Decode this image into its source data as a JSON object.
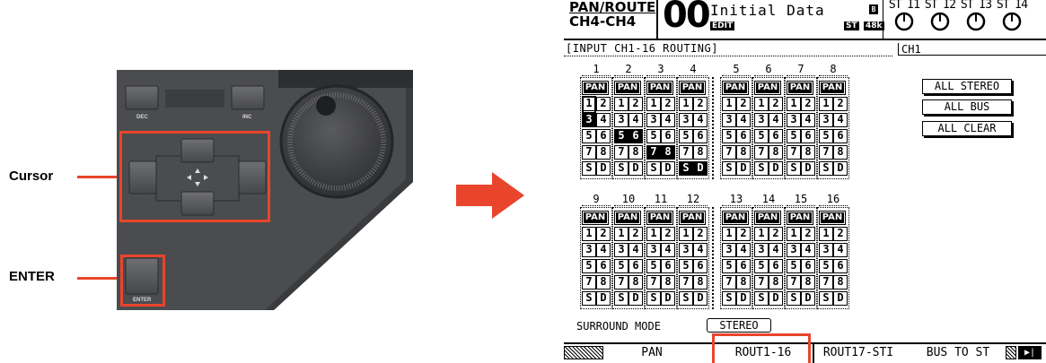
{
  "callouts": {
    "cursor": "Cursor",
    "enter": "ENTER"
  },
  "hardware": {
    "dec_label": "DEC",
    "inc_label": "INC",
    "enter_label": "ENTER",
    "accent": "#e8452c",
    "panel_color": "#4a4b4d"
  },
  "lcd": {
    "title_line1": "PAN/ROUTE",
    "title_line2": "CH4-CH4",
    "scene_number": "00",
    "scene_title": "Initial Data",
    "edit_badge": "EDIT",
    "st_badge": "ST",
    "fs_badge": "48k",
    "b_badge": "B",
    "stereo_inputs": [
      "ST I1",
      "ST I2",
      "ST I3",
      "ST I4"
    ],
    "section_title": "INPUT CH1-16 ROUTING",
    "channel_name": "CH1",
    "pan_label": "PAN",
    "bus_labels": [
      "1",
      "2",
      "3",
      "4",
      "5",
      "6",
      "7",
      "8"
    ],
    "stereo_label": "S",
    "direct_label": "D",
    "group1_channels": [
      "1",
      "2",
      "3",
      "4",
      "5",
      "6",
      "7",
      "8"
    ],
    "group2_channels": [
      "9",
      "10",
      "11",
      "12",
      "13",
      "14",
      "15",
      "16"
    ],
    "buttons": {
      "all_stereo": "ALL STEREO",
      "all_bus": "ALL BUS",
      "all_clear": "ALL CLEAR"
    },
    "surround_label": "SURROUND MODE",
    "surround_value": "STEREO",
    "tabs": [
      "PAN",
      "ROUT1-16",
      "ROUT17-STI",
      "BUS TO ST"
    ],
    "selected_tab": "ROUT1-16"
  }
}
